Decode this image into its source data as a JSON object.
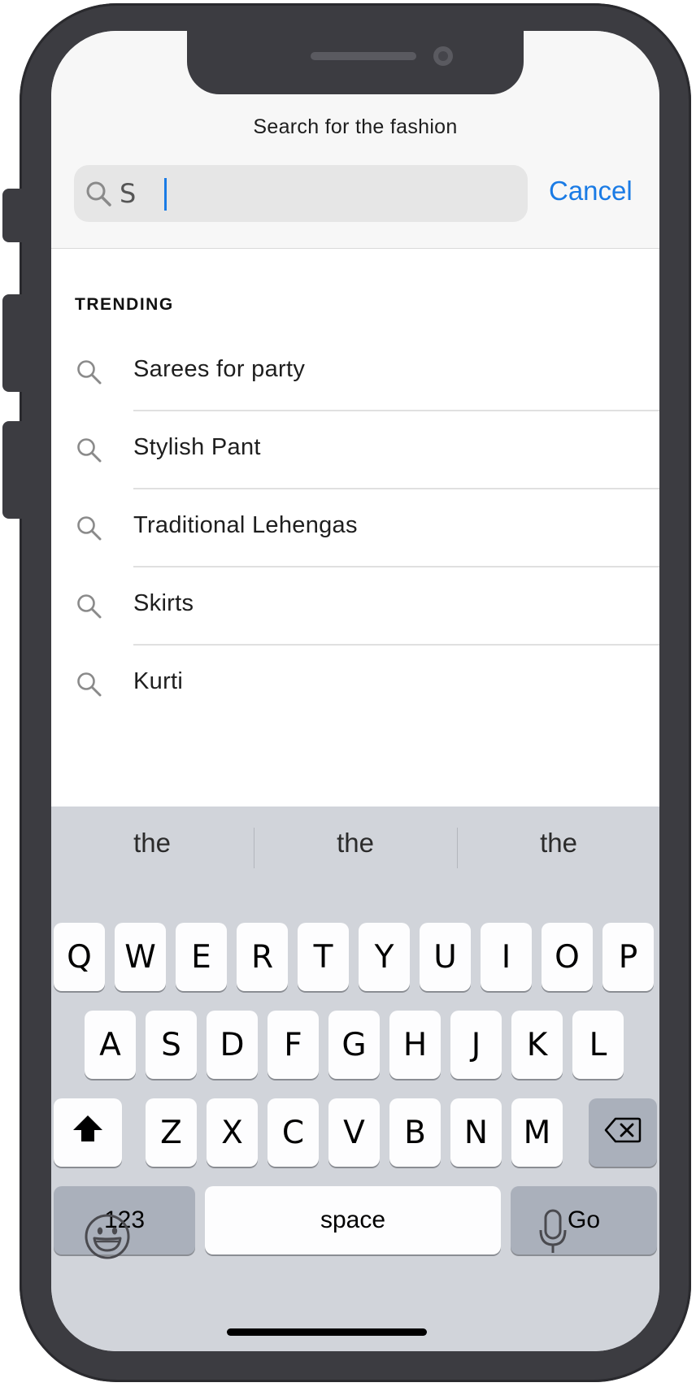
{
  "header": {
    "title": "Search for the fashion",
    "search_value": "S",
    "cancel_label": "Cancel"
  },
  "trending": {
    "label": "TRENDING",
    "items": [
      {
        "label": "Sarees for party"
      },
      {
        "label": "Stylish Pant"
      },
      {
        "label": "Traditional Lehengas"
      },
      {
        "label": "Skirts"
      },
      {
        "label": "Kurti"
      }
    ]
  },
  "keyboard": {
    "suggestions": [
      "the",
      "the",
      "the"
    ],
    "row1": [
      "Q",
      "W",
      "E",
      "R",
      "T",
      "Y",
      "U",
      "I",
      "O",
      "P"
    ],
    "row2": [
      "A",
      "S",
      "D",
      "F",
      "G",
      "H",
      "J",
      "K",
      "L"
    ],
    "row3": [
      "Z",
      "X",
      "C",
      "V",
      "B",
      "N",
      "M"
    ],
    "numbers_label": "123",
    "space_label": "space",
    "go_label": "Go",
    "icons": {
      "shift": "shift-icon",
      "delete": "backspace-icon",
      "emoji": "emoji-icon",
      "mic": "microphone-icon"
    }
  },
  "colors": {
    "accent": "#1a7be5",
    "keyboard_bg": "#d1d4da",
    "key_dark": "#aab0bb"
  }
}
